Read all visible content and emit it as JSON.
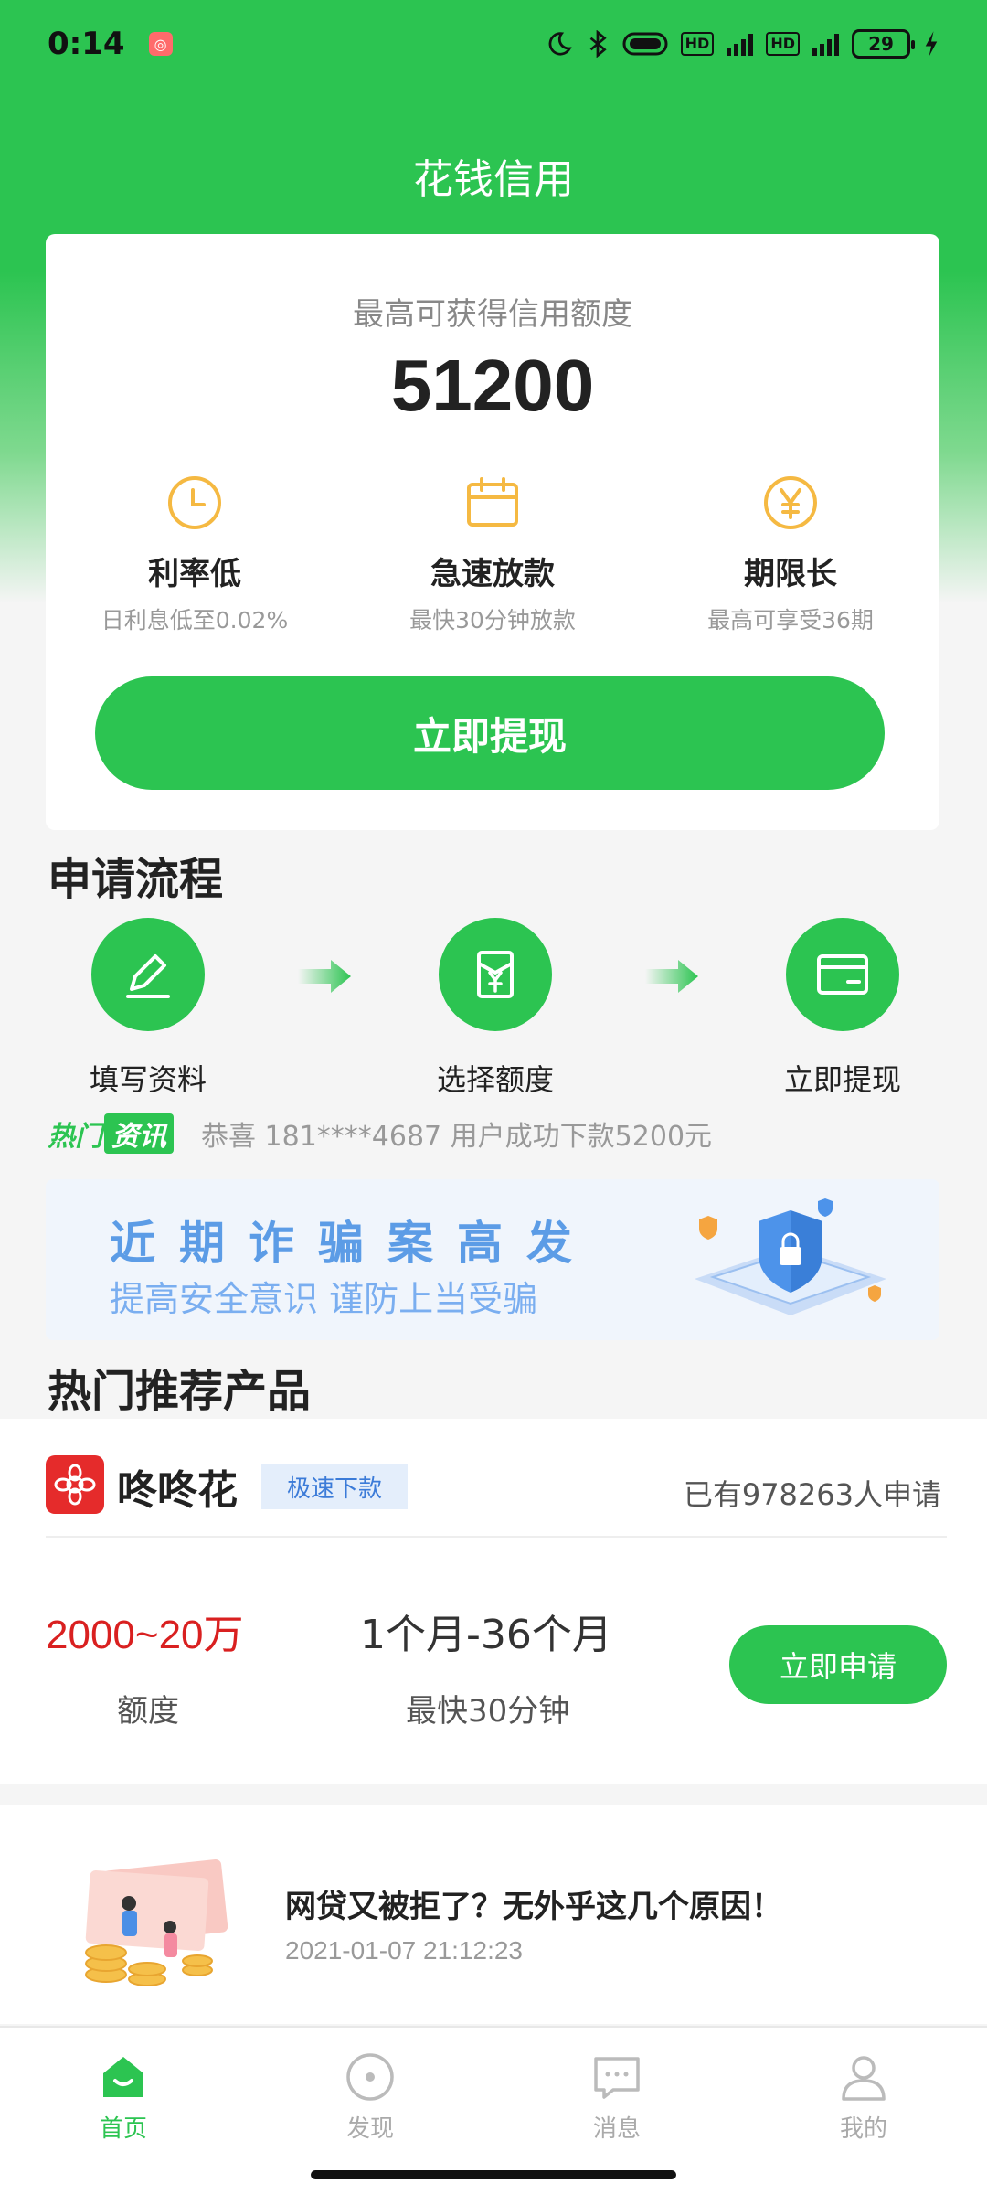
{
  "status_bar": {
    "time": "0:14",
    "battery": "29",
    "hd_label": "HD",
    "network": "4G"
  },
  "app": {
    "title": "花钱信用"
  },
  "credit_card": {
    "label": "最高可获得信用额度",
    "amount": "51200",
    "features": [
      {
        "icon": "clock-icon",
        "title": "利率低",
        "sub": "日利息低至0.02%"
      },
      {
        "icon": "calendar-icon",
        "title": "急速放款",
        "sub": "最快30分钟放款"
      },
      {
        "icon": "yen-icon",
        "title": "期限长",
        "sub": "最高可享受36期"
      }
    ],
    "button_label": "立即提现"
  },
  "process": {
    "title": "申请流程",
    "steps": [
      {
        "icon": "pencil-icon",
        "label": "填写资料"
      },
      {
        "icon": "yen-document-icon",
        "label": "选择额度"
      },
      {
        "icon": "card-icon",
        "label": "立即提现"
      }
    ]
  },
  "news": {
    "tag_part1": "热门",
    "tag_part2": "资讯",
    "text": "恭喜 181****4687 用户成功下款5200元"
  },
  "banner": {
    "line1": "近期诈骗案高发",
    "line2": "提高安全意识 谨防上当受骗"
  },
  "products": {
    "title": "热门推荐产品",
    "items": [
      {
        "name": "咚咚花",
        "tag": "极速下款",
        "applied": "已有978263人申请",
        "range": "2000~20万",
        "range_label": "额度",
        "term": "1个月-36个月",
        "term_label": "最快30分钟",
        "button": "立即申请"
      }
    ]
  },
  "article": {
    "title": "网贷又被拒了？无外乎这几个原因！",
    "time": "2021-01-07 21:12:23"
  },
  "tabs": [
    {
      "label": "首页",
      "icon": "home-icon",
      "active": true
    },
    {
      "label": "发现",
      "icon": "discover-icon",
      "active": false
    },
    {
      "label": "消息",
      "icon": "message-icon",
      "active": false
    },
    {
      "label": "我的",
      "icon": "profile-icon",
      "active": false
    }
  ],
  "colors": {
    "brand_green": "#2cc451",
    "accent_orange": "#f5b942",
    "price_red": "#d92020",
    "tag_blue": "#3b7bd8"
  }
}
